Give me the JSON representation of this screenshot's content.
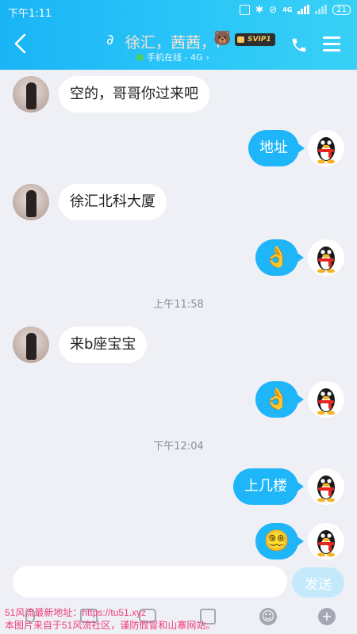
{
  "status_bar": {
    "time": "下午1:11",
    "network_label": "4G",
    "battery": "21"
  },
  "header": {
    "title": "徐汇，茜茜，f",
    "badge": "SVIP1",
    "subtitle": "手机在线 - 4G",
    "subtitle_chevron": "›",
    "icons": {
      "back": "back-chevron-icon",
      "ear": "ear-icon",
      "bear": "bear-emoji-icon",
      "phone": "phone-icon",
      "menu": "menu-icon"
    }
  },
  "messages": [
    {
      "side": "incoming",
      "text": "空的，哥哥你过来吧"
    },
    {
      "side": "outgoing",
      "text": "地址"
    },
    {
      "side": "incoming",
      "text": "徐汇北科大厦"
    },
    {
      "side": "outgoing",
      "text": "👌"
    },
    {
      "side": "timestamp",
      "text": "上午11:58"
    },
    {
      "side": "incoming",
      "text": "来b座宝宝"
    },
    {
      "side": "outgoing",
      "text": "👌"
    },
    {
      "side": "timestamp",
      "text": "下午12:04"
    },
    {
      "side": "outgoing",
      "text": "上几楼"
    },
    {
      "side": "outgoing",
      "text": "😵‍💫"
    }
  ],
  "composer": {
    "input_value": "",
    "send_label": "发送"
  },
  "toolbar": {
    "icons": [
      "microphone-icon",
      "image-icon",
      "camera-icon",
      "red-packet-icon",
      "emoji-icon",
      "plus-icon"
    ],
    "emoji_glyph": "☺",
    "plus_glyph": "+"
  },
  "watermark": {
    "line1": "51风流最新地址：https://tu51.xyz",
    "line2": "本图片来自于51风流社区，谨防假冒和山寨网站。"
  },
  "colors": {
    "header_gradient_start": "#19b4f6",
    "header_gradient_end": "#38d0f5",
    "outgoing_bubble": "#1fb5f9",
    "incoming_bubble": "#ffffff",
    "chat_background": "#eef0f6",
    "send_button": "#c3e9fb",
    "watermark": "#f03c7a"
  }
}
